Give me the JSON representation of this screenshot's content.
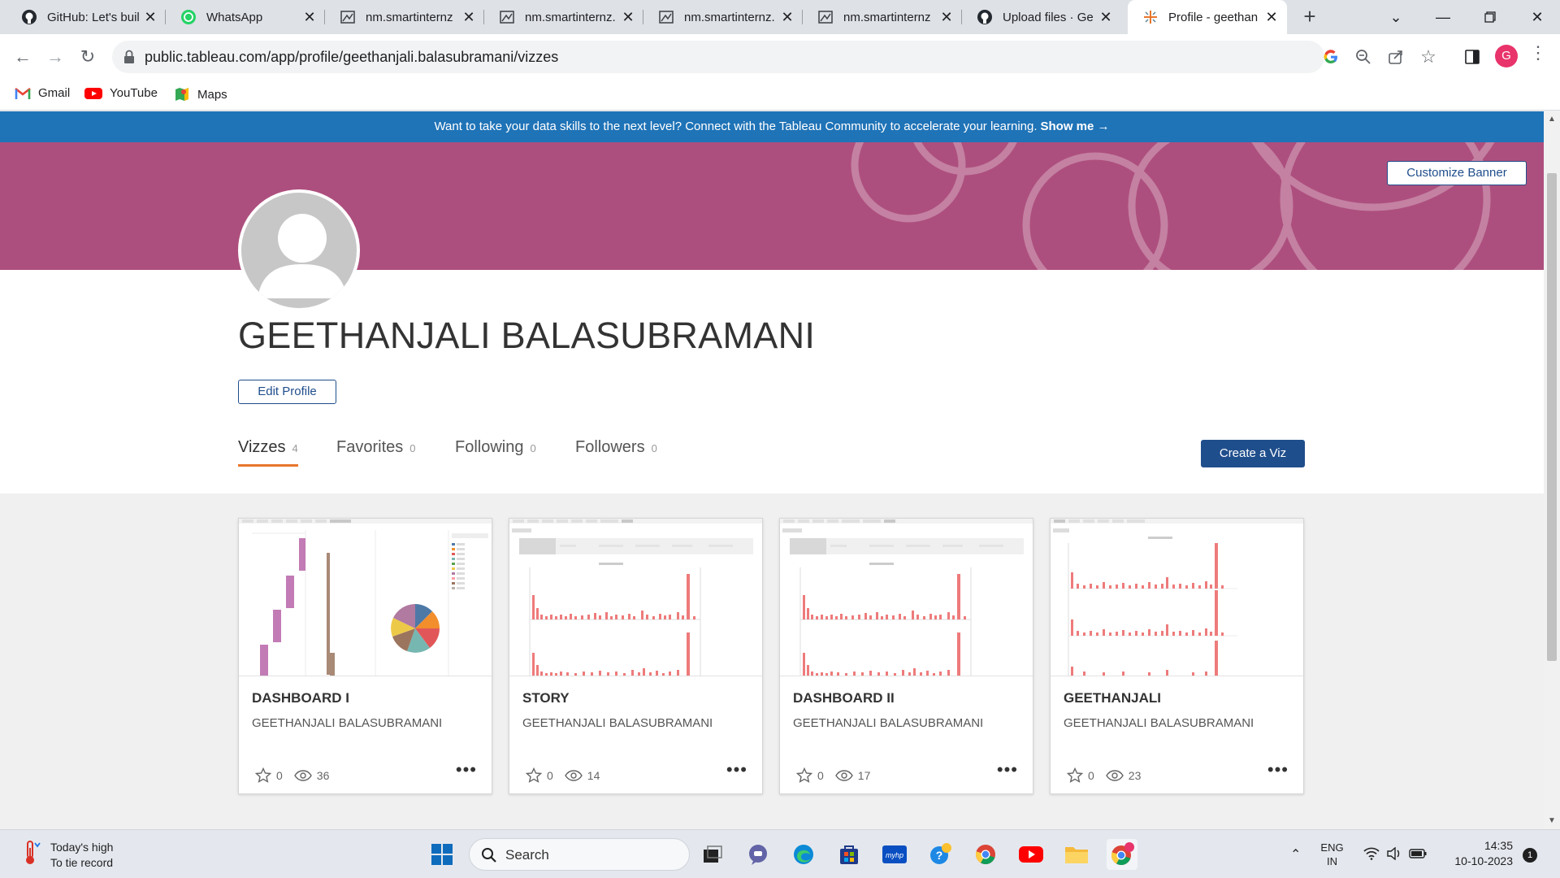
{
  "browser": {
    "tabs": [
      {
        "title": "GitHub: Let's buil",
        "icon": "github-icon"
      },
      {
        "title": "WhatsApp",
        "icon": "whatsapp-icon"
      },
      {
        "title": "nm.smartinternz",
        "icon": "page-icon"
      },
      {
        "title": "nm.smartinternz.",
        "icon": "page-icon"
      },
      {
        "title": "nm.smartinternz.",
        "icon": "page-icon"
      },
      {
        "title": "nm.smartinternz",
        "icon": "page-icon"
      },
      {
        "title": "Upload files · Ge",
        "icon": "github-icon"
      },
      {
        "title": "Profile - geethan",
        "icon": "tableau-icon"
      }
    ],
    "url": "public.tableau.com/app/profile/geethanjali.balasubramani/vizzes",
    "profile_initial": "G",
    "bookmarks": [
      {
        "label": "Gmail",
        "icon": "gmail-icon"
      },
      {
        "label": "YouTube",
        "icon": "youtube-icon"
      },
      {
        "label": "Maps",
        "icon": "maps-icon"
      }
    ]
  },
  "page": {
    "promo_text": "Want to take your data skills to the next level? Connect with the Tableau Community to accelerate your learning.",
    "promo_link": "Show me →",
    "customize_banner": "Customize Banner",
    "profile_name": "GEETHANJALI BALASUBRAMANI",
    "edit_profile": "Edit Profile",
    "tabs": [
      {
        "label": "Vizzes",
        "count": "4"
      },
      {
        "label": "Favorites",
        "count": "0"
      },
      {
        "label": "Following",
        "count": "0"
      },
      {
        "label": "Followers",
        "count": "0"
      }
    ],
    "create_viz": "Create a Viz",
    "banner_color": "#ad4f7e",
    "accent_color": "#e8762d",
    "cards": [
      {
        "title": "DASHBOARD I",
        "author": "GEETHANJALI BALASUBRAMANI",
        "favorites": "0",
        "views": "36"
      },
      {
        "title": "STORY",
        "author": "GEETHANJALI BALASUBRAMANI",
        "favorites": "0",
        "views": "14"
      },
      {
        "title": "DASHBOARD II",
        "author": "GEETHANJALI BALASUBRAMANI",
        "favorites": "0",
        "views": "17"
      },
      {
        "title": "GEETHANJALI",
        "author": "GEETHANJALI BALASUBRAMANI",
        "favorites": "0",
        "views": "23"
      }
    ]
  },
  "taskbar": {
    "weather_line1": "Today's high",
    "weather_line2": "To tie record",
    "search_label": "Search",
    "lang_line1": "ENG",
    "lang_line2": "IN",
    "time": "14:35",
    "date": "10-10-2023",
    "notifications": "1"
  }
}
